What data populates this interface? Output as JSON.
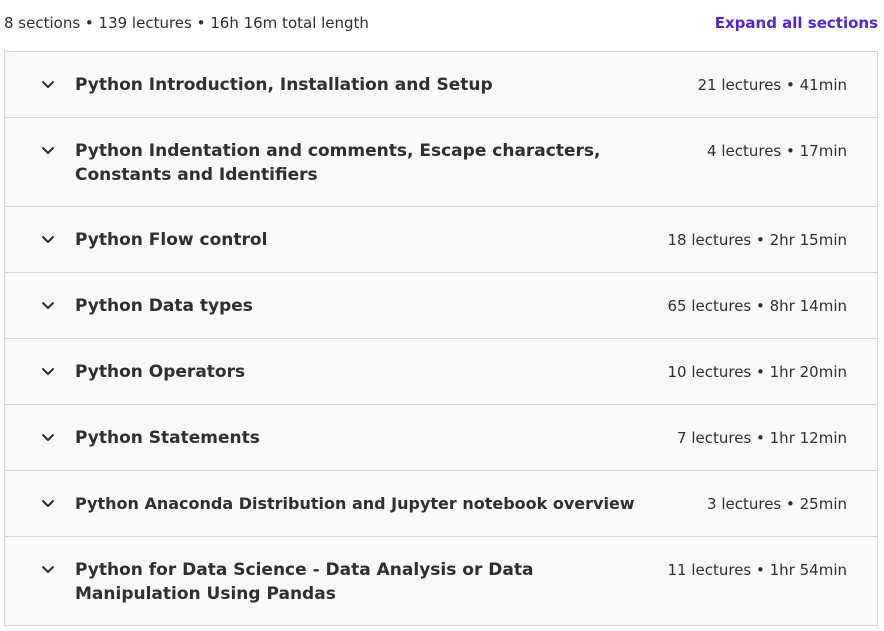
{
  "summary": "8 sections • 139 lectures • 16h 16m total length",
  "expand_all_label": "Expand all sections",
  "sections": [
    {
      "title": "Python Introduction, Installation and Setup",
      "meta": "21 lectures • 41min"
    },
    {
      "title": "Python Indentation and comments, Escape characters, Constants and Identifiers",
      "meta": "4 lectures • 17min"
    },
    {
      "title": "Python Flow control",
      "meta": "18 lectures • 2hr 15min"
    },
    {
      "title": "Python Data types",
      "meta": "65 lectures • 8hr 14min"
    },
    {
      "title": "Python Operators",
      "meta": "10 lectures • 1hr 20min"
    },
    {
      "title": "Python Statements",
      "meta": "7 lectures • 1hr 12min"
    },
    {
      "title": "Python Anaconda Distribution and Jupyter notebook overview",
      "meta": "3 lectures • 25min"
    },
    {
      "title": "Python for Data Science - Data Analysis or Data Manipulation Using Pandas",
      "meta": "11 lectures • 1hr 54min"
    }
  ],
  "icons": {
    "expand": "chevron-down-icon"
  },
  "colors": {
    "accent": "#5624d0",
    "section_bg": "#f7f9fa",
    "border": "#d1d7dc",
    "text": "#2d2f31"
  }
}
